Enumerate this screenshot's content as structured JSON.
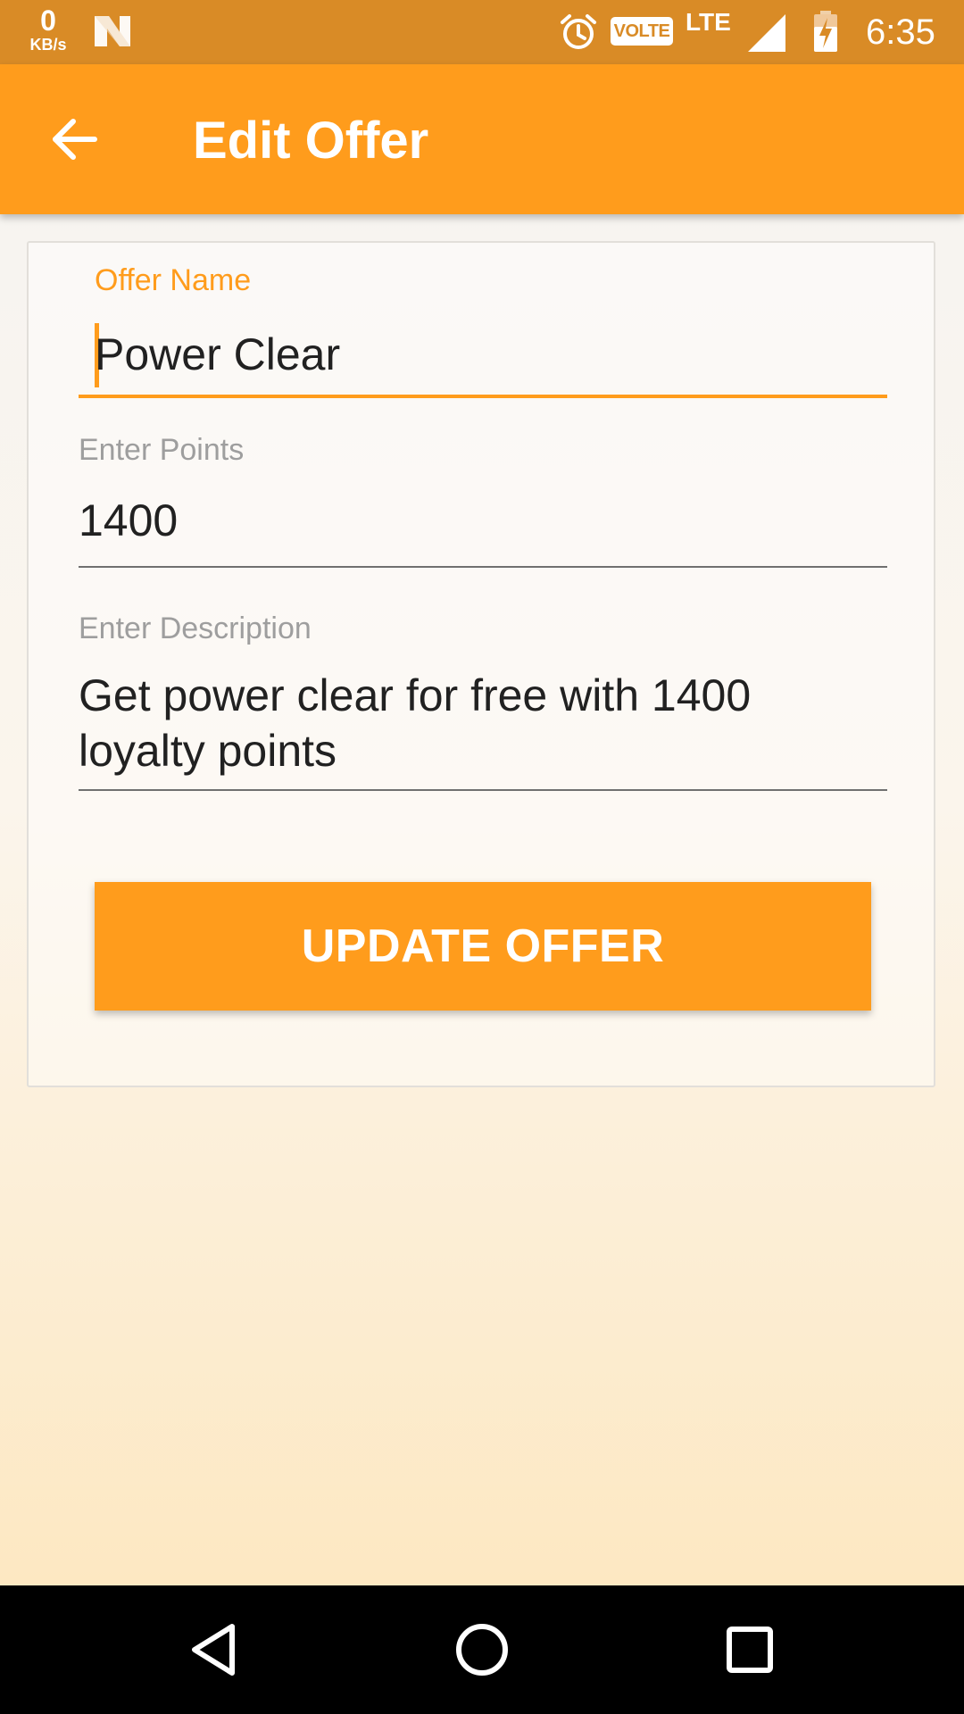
{
  "status_bar": {
    "net_speed_value": "0",
    "net_speed_unit": "KB/s",
    "volte_label": "VOLTE",
    "network_type": "LTE",
    "time": "6:35",
    "icons": [
      "n-notification-icon",
      "alarm-icon",
      "signal-icon",
      "battery-charging-icon"
    ]
  },
  "app_bar": {
    "title": "Edit Offer",
    "back_icon": "arrow-left-icon"
  },
  "form": {
    "offer_name": {
      "label": "Offer Name",
      "value": "Power Clear"
    },
    "points": {
      "label": "Enter Points",
      "value": "1400"
    },
    "description": {
      "label": "Enter Description",
      "value_line1": "Get power clear for free with 1400",
      "value_line2": "loyalty points"
    },
    "submit_label": "UPDATE OFFER"
  },
  "nav_bar": {
    "icons": [
      "back-triangle-icon",
      "home-circle-icon",
      "recents-square-icon"
    ]
  },
  "colors": {
    "accent": "#ff9c1c",
    "status_bar": "#d98b26",
    "nav_bar": "#000000"
  }
}
